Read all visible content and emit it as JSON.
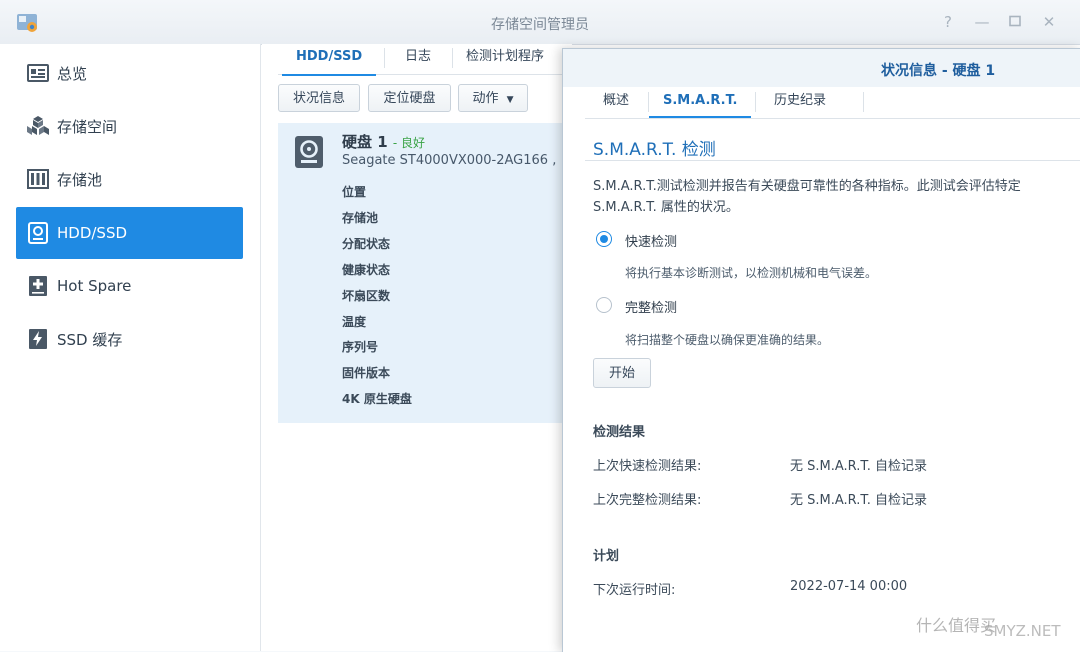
{
  "window": {
    "title": "存储空间管理员"
  },
  "sidebar": {
    "items": [
      {
        "label": "总览",
        "icon": "overview-icon"
      },
      {
        "label": "存储空间",
        "icon": "storage-volume-icon"
      },
      {
        "label": "存储池",
        "icon": "storage-pool-icon"
      },
      {
        "label": "HDD/SSD",
        "icon": "hdd-icon",
        "active": true
      },
      {
        "label": "Hot Spare",
        "icon": "hot-spare-icon"
      },
      {
        "label": "SSD 缓存",
        "icon": "ssd-cache-icon"
      }
    ]
  },
  "main": {
    "tabs": [
      "HDD/SSD",
      "日志",
      "检测计划程序"
    ],
    "buttons": {
      "status": "状况信息",
      "locate": "定位硬盘",
      "action": "动作"
    },
    "disk": {
      "name": "硬盘 1",
      "status": "- 良好",
      "model": "Seagate ST4000VX000-2AG166 ,",
      "properties": [
        "位置",
        "存储池",
        "分配状态",
        "健康状态",
        "坏扇区数",
        "温度",
        "序列号",
        "固件版本",
        "4K 原生硬盘"
      ]
    }
  },
  "dialog": {
    "title": "状况信息 - 硬盘 1",
    "tabs": [
      "概述",
      "S.M.A.R.T.",
      "历史纪录"
    ],
    "section_title": "S.M.A.R.T. 检测",
    "description": "S.M.A.R.T.测试检测并报告有关硬盘可靠性的各种指标。此测试会评估特定 S.M.A.R.T. 属性的状况。",
    "options": [
      {
        "label": "快速检测",
        "desc": "将执行基本诊断测试，以检测机械和电气误差。",
        "checked": true
      },
      {
        "label": "完整检测",
        "desc": "将扫描整个硬盘以确保更准确的结果。",
        "checked": false
      }
    ],
    "start_button": "开始",
    "results": {
      "title": "检测结果",
      "rows": [
        {
          "key": "上次快速检测结果:",
          "value": "无 S.M.A.R.T. 自检记录"
        },
        {
          "key": "上次完整检测结果:",
          "value": "无 S.M.A.R.T. 自检记录"
        }
      ]
    },
    "schedule": {
      "title": "计划",
      "key": "下次运行时间:",
      "value": "2022-07-14 00:00"
    }
  },
  "watermark": {
    "text": "什么值得买",
    "site": "SMYZ.NET"
  },
  "colors": {
    "accent": "#1f8ae3",
    "good": "#3aa346",
    "title_blue": "#1f6fb8"
  }
}
